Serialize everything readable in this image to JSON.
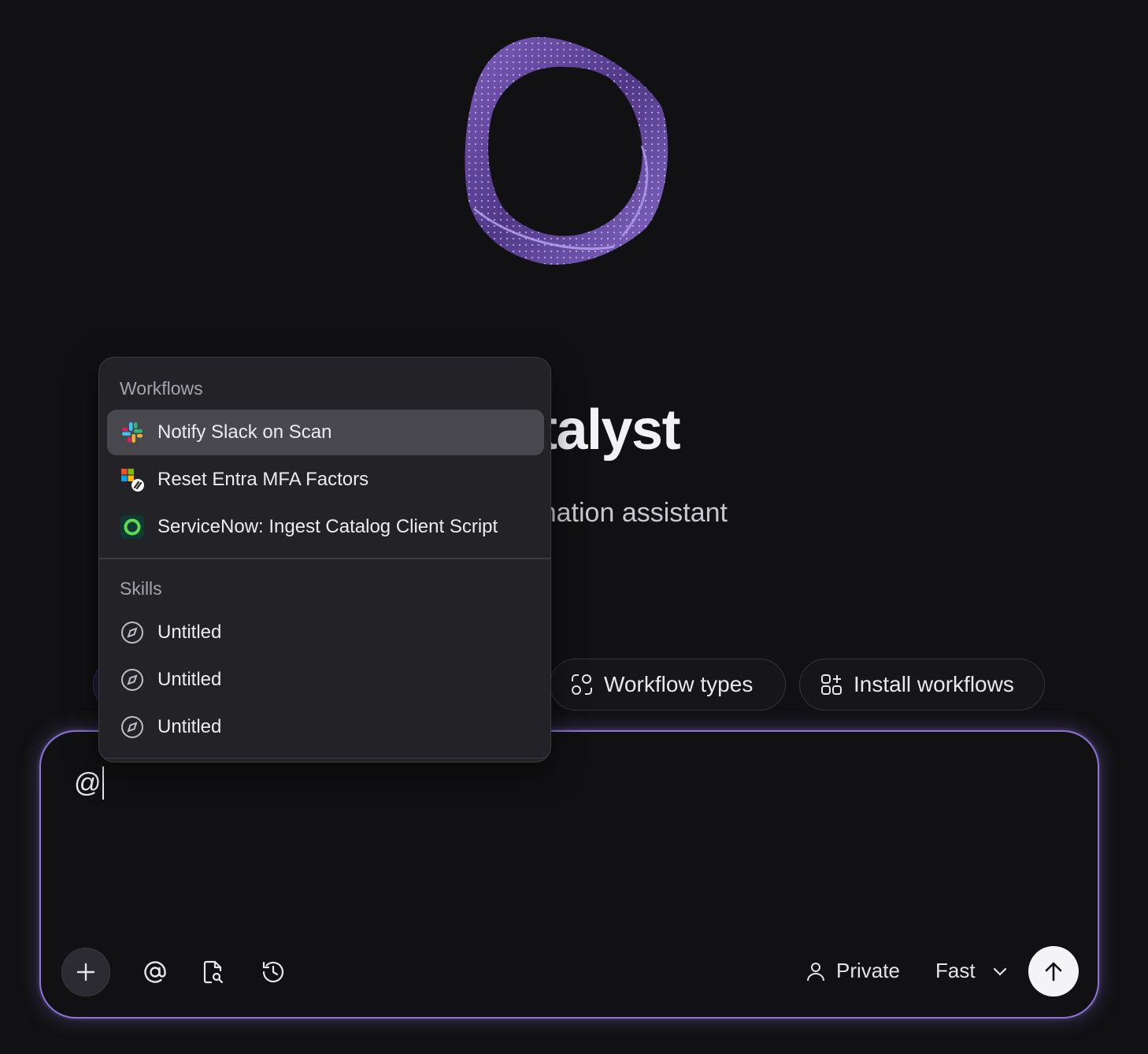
{
  "hero": {
    "title": "Catalyst",
    "subtitle": "Your automation assistant"
  },
  "suggestions": [
    {
      "label": "",
      "icon": "suggestion-icon"
    },
    {
      "label": "Workflow types",
      "icon": "workflow-types-icon"
    },
    {
      "label": "Install workflows",
      "icon": "install-workflows-icon"
    }
  ],
  "mention_menu": {
    "workflows_heading": "Workflows",
    "workflows": [
      {
        "label": "Notify Slack on Scan",
        "icon": "slack-icon",
        "active": true
      },
      {
        "label": "Reset Entra MFA Factors",
        "icon": "entra-okta-icon",
        "active": false
      },
      {
        "label": "ServiceNow: Ingest Catalog Client Script",
        "icon": "servicenow-icon",
        "active": false
      }
    ],
    "skills_heading": "Skills",
    "skills": [
      {
        "label": "Untitled",
        "icon": "compass-icon"
      },
      {
        "label": "Untitled",
        "icon": "compass-icon"
      },
      {
        "label": "Untitled",
        "icon": "compass-icon"
      }
    ]
  },
  "composer": {
    "value": "@",
    "toolbar": {
      "add": "plus-icon",
      "mention": "at-icon",
      "search_docs": "document-search-icon",
      "history": "history-icon"
    },
    "privacy_label": "Private",
    "model_label": "Fast",
    "send": "arrow-up-icon"
  },
  "colors": {
    "background": "#111113",
    "accent": "#8d74d6",
    "menu_bg": "#232327",
    "menu_active": "#48484e"
  }
}
